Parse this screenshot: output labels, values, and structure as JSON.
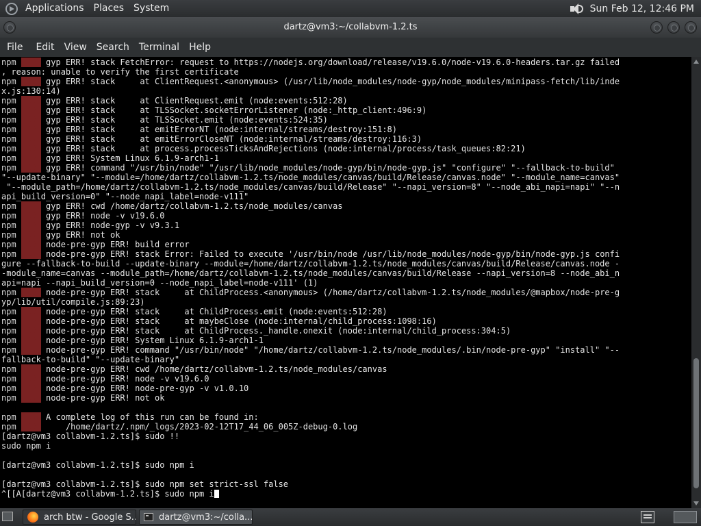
{
  "top_panel": {
    "menus": [
      "Applications",
      "Places",
      "System"
    ],
    "clock": "Sun Feb 12, 12:46 PM"
  },
  "window": {
    "title": "dartz@vm3:~/collabvm-1.2.ts",
    "menu": [
      "File",
      "Edit",
      "View",
      "Search",
      "Terminal",
      "Help"
    ]
  },
  "terminal": {
    "badge": "ERR!",
    "lines": [
      {
        "npm": "npm",
        "badge": true,
        "text": " gyp ERR! stack FetchError: request to https://nodejs.org/download/release/v19.6.0/node-v19.6.0-headers.tar.gz failed"
      },
      {
        "npm": "",
        "badge": false,
        "text": ", reason: unable to verify the first certificate"
      },
      {
        "npm": "npm",
        "badge": true,
        "text": " gyp ERR! stack     at ClientRequest.<anonymous> (/usr/lib/node_modules/node-gyp/node_modules/minipass-fetch/lib/inde"
      },
      {
        "npm": "",
        "badge": false,
        "text": "x.js:130:14)"
      },
      {
        "npm": "npm",
        "badge": true,
        "text": " gyp ERR! stack     at ClientRequest.emit (node:events:512:28)"
      },
      {
        "npm": "npm",
        "badge": true,
        "text": " gyp ERR! stack     at TLSSocket.socketErrorListener (node:_http_client:496:9)"
      },
      {
        "npm": "npm",
        "badge": true,
        "text": " gyp ERR! stack     at TLSSocket.emit (node:events:524:35)"
      },
      {
        "npm": "npm",
        "badge": true,
        "text": " gyp ERR! stack     at emitErrorNT (node:internal/streams/destroy:151:8)"
      },
      {
        "npm": "npm",
        "badge": true,
        "text": " gyp ERR! stack     at emitErrorCloseNT (node:internal/streams/destroy:116:3)"
      },
      {
        "npm": "npm",
        "badge": true,
        "text": " gyp ERR! stack     at process.processTicksAndRejections (node:internal/process/task_queues:82:21)"
      },
      {
        "npm": "npm",
        "badge": true,
        "text": " gyp ERR! System Linux 6.1.9-arch1-1"
      },
      {
        "npm": "npm",
        "badge": true,
        "text": " gyp ERR! command \"/usr/bin/node\" \"/usr/lib/node_modules/node-gyp/bin/node-gyp.js\" \"configure\" \"--fallback-to-build\""
      },
      {
        "npm": "",
        "badge": false,
        "text": "\"--update-binary\" \"--module=/home/dartz/collabvm-1.2.ts/node_modules/canvas/build/Release/canvas.node\" \"--module_name=canvas\""
      },
      {
        "npm": "",
        "badge": false,
        "text": " \"--module_path=/home/dartz/collabvm-1.2.ts/node_modules/canvas/build/Release\" \"--napi_version=8\" \"--node_abi_napi=napi\" \"--n"
      },
      {
        "npm": "",
        "badge": false,
        "text": "api_build_version=0\" \"--node_napi_label=node-v111\""
      },
      {
        "npm": "npm",
        "badge": true,
        "text": " gyp ERR! cwd /home/dartz/collabvm-1.2.ts/node_modules/canvas"
      },
      {
        "npm": "npm",
        "badge": true,
        "text": " gyp ERR! node -v v19.6.0"
      },
      {
        "npm": "npm",
        "badge": true,
        "text": " gyp ERR! node-gyp -v v9.3.1"
      },
      {
        "npm": "npm",
        "badge": true,
        "text": " gyp ERR! not ok"
      },
      {
        "npm": "npm",
        "badge": true,
        "text": " node-pre-gyp ERR! build error"
      },
      {
        "npm": "npm",
        "badge": true,
        "text": " node-pre-gyp ERR! stack Error: Failed to execute '/usr/bin/node /usr/lib/node_modules/node-gyp/bin/node-gyp.js confi"
      },
      {
        "npm": "",
        "badge": false,
        "text": "gure --fallback-to-build --update-binary --module=/home/dartz/collabvm-1.2.ts/node_modules/canvas/build/Release/canvas.node -"
      },
      {
        "npm": "",
        "badge": false,
        "text": "-module_name=canvas --module_path=/home/dartz/collabvm-1.2.ts/node_modules/canvas/build/Release --napi_version=8 --node_abi_n"
      },
      {
        "npm": "",
        "badge": false,
        "text": "api=napi --napi_build_version=0 --node_napi_label=node-v111' (1)"
      },
      {
        "npm": "npm",
        "badge": true,
        "text": " node-pre-gyp ERR! stack     at ChildProcess.<anonymous> (/home/dartz/collabvm-1.2.ts/node_modules/@mapbox/node-pre-g"
      },
      {
        "npm": "",
        "badge": false,
        "text": "yp/lib/util/compile.js:89:23)"
      },
      {
        "npm": "npm",
        "badge": true,
        "text": " node-pre-gyp ERR! stack     at ChildProcess.emit (node:events:512:28)"
      },
      {
        "npm": "npm",
        "badge": true,
        "text": " node-pre-gyp ERR! stack     at maybeClose (node:internal/child_process:1098:16)"
      },
      {
        "npm": "npm",
        "badge": true,
        "text": " node-pre-gyp ERR! stack     at ChildProcess._handle.onexit (node:internal/child_process:304:5)"
      },
      {
        "npm": "npm",
        "badge": true,
        "text": " node-pre-gyp ERR! System Linux 6.1.9-arch1-1"
      },
      {
        "npm": "npm",
        "badge": true,
        "text": " node-pre-gyp ERR! command \"/usr/bin/node\" \"/home/dartz/collabvm-1.2.ts/node_modules/.bin/node-pre-gyp\" \"install\" \"--"
      },
      {
        "npm": "",
        "badge": false,
        "text": "fallback-to-build\" \"--update-binary\""
      },
      {
        "npm": "npm",
        "badge": true,
        "text": " node-pre-gyp ERR! cwd /home/dartz/collabvm-1.2.ts/node_modules/canvas"
      },
      {
        "npm": "npm",
        "badge": true,
        "text": " node-pre-gyp ERR! node -v v19.6.0"
      },
      {
        "npm": "npm",
        "badge": true,
        "text": " node-pre-gyp ERR! node-pre-gyp -v v1.0.10"
      },
      {
        "npm": "npm",
        "badge": true,
        "text": " node-pre-gyp ERR! not ok"
      },
      {
        "npm": "",
        "badge": false,
        "text": ""
      },
      {
        "npm": "npm",
        "badge": true,
        "text": " A complete log of this run can be found in:"
      },
      {
        "npm": "npm",
        "badge": true,
        "text": "     /home/dartz/.npm/_logs/2023-02-12T17_44_06_005Z-debug-0.log"
      },
      {
        "npm": "",
        "badge": false,
        "text": "[dartz@vm3 collabvm-1.2.ts]$ sudo !!"
      },
      {
        "npm": "",
        "badge": false,
        "text": "sudo npm i"
      },
      {
        "npm": "",
        "badge": false,
        "text": ""
      },
      {
        "npm": "",
        "badge": false,
        "text": "[dartz@vm3 collabvm-1.2.ts]$ sudo npm i"
      },
      {
        "npm": "",
        "badge": false,
        "text": ""
      },
      {
        "npm": "",
        "badge": false,
        "text": "[dartz@vm3 collabvm-1.2.ts]$ sudo npm set strict-ssl false"
      },
      {
        "npm": "",
        "badge": false,
        "text": "^[[A[dartz@vm3 collabvm-1.2.ts]$ sudo npm i",
        "cursor": true
      }
    ]
  },
  "taskbar": {
    "tasks": [
      {
        "label": "arch btw - Google S...",
        "icon": "firefox-icon"
      },
      {
        "label": "dartz@vm3:~/colla...",
        "icon": "terminal-icon"
      }
    ]
  }
}
